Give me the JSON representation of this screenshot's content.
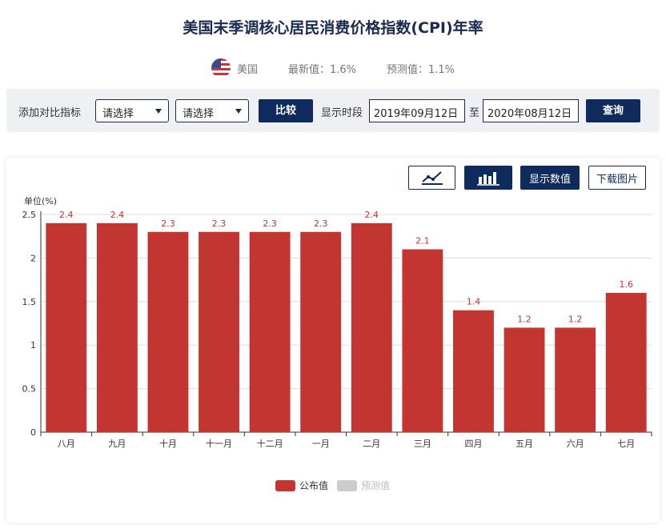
{
  "page": {
    "title": "美国末季调核心居民消费价格指数(CPI)年率",
    "country": "美国",
    "latest": "最新值：1.6%",
    "forecast": "预测值：1.1%"
  },
  "filter": {
    "compare_label": "添加对比指标",
    "select1": "请选择",
    "select2": "请选择",
    "compare_button": "比较",
    "period_label": "显示时段",
    "start_date": "2019年09月12日",
    "to_label": "至",
    "end_date": "2020年08月12日",
    "query_button": "查询"
  },
  "toolbar": {
    "line_icon": "line-chart-icon",
    "bar_icon": "bar-chart-icon",
    "show_values": "显示数值",
    "download": "下载图片"
  },
  "colors": {
    "bar": "#c23531",
    "navy": "#0f2a5c",
    "forecast": "#cccccc"
  },
  "chart_data": {
    "type": "bar",
    "ylabel": "单位(%)",
    "ylim": [
      0,
      2.5
    ],
    "yticks": [
      "0",
      "0.5",
      "1",
      "1.5",
      "2",
      "2.5"
    ],
    "categories": [
      "八月",
      "九月",
      "十月",
      "十一月",
      "十二月",
      "一月",
      "二月",
      "三月",
      "四月",
      "五月",
      "六月",
      "七月"
    ],
    "series": [
      {
        "name": "公布值",
        "values": [
          2.4,
          2.4,
          2.3,
          2.3,
          2.3,
          2.3,
          2.4,
          2.1,
          1.4,
          1.2,
          1.2,
          1.6
        ]
      }
    ],
    "legend": [
      {
        "name": "公布值",
        "active": true
      },
      {
        "name": "预测值",
        "active": false
      }
    ],
    "legend_position": "bottom",
    "grid": true
  }
}
